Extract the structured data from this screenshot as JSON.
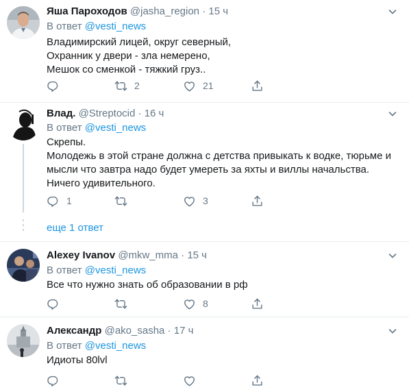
{
  "tweets": [
    {
      "name": "Яша Пароходов",
      "handle": "@jasha_region",
      "sep": "·",
      "time": "15 ч",
      "reply_prefix": "В ответ",
      "reply_mention": "@vesti_news",
      "lines": [
        "Владимирский лицей, округ северный,",
        "Охранник у двери - зла немерено,",
        "Мешок со сменкой - тяжкий груз.."
      ],
      "replies": "",
      "retweets": "2",
      "likes": "21"
    },
    {
      "name": "Влад.",
      "handle": "@Streptocid",
      "sep": "·",
      "time": "16 ч",
      "reply_prefix": "В ответ",
      "reply_mention": "@vesti_news",
      "lines": [
        "Скрепы.",
        "Молодежь в этой стране должна с детства привыкать к водке, тюрьме и",
        "мысли что завтра надо будет умереть за яхты и виллы начальства.",
        "Ничего удивительного."
      ],
      "replies": "1",
      "retweets": "",
      "likes": "3",
      "more_replies": "еще 1 ответ"
    },
    {
      "name": "Alexey Ivanov",
      "handle": "@mkw_mma",
      "sep": "·",
      "time": "15 ч",
      "reply_prefix": "В ответ",
      "reply_mention": "@vesti_news",
      "lines": [
        "Все что нужно знать об образовании в рф"
      ],
      "replies": "",
      "retweets": "",
      "likes": "8"
    },
    {
      "name": "Александр",
      "handle": "@ako_sasha",
      "sep": "·",
      "time": "17 ч",
      "reply_prefix": "В ответ",
      "reply_mention": "@vesti_news",
      "lines": [
        "Идиоты 80lvl"
      ],
      "replies": "",
      "retweets": "",
      "likes": ""
    }
  ],
  "colors": {
    "text": "#14171a",
    "secondary": "#657786",
    "link": "#1b95e0",
    "divider": "#e6ecf0"
  },
  "icons": [
    "reply-icon",
    "retweet-icon",
    "like-icon",
    "share-icon",
    "caret-down-icon"
  ]
}
